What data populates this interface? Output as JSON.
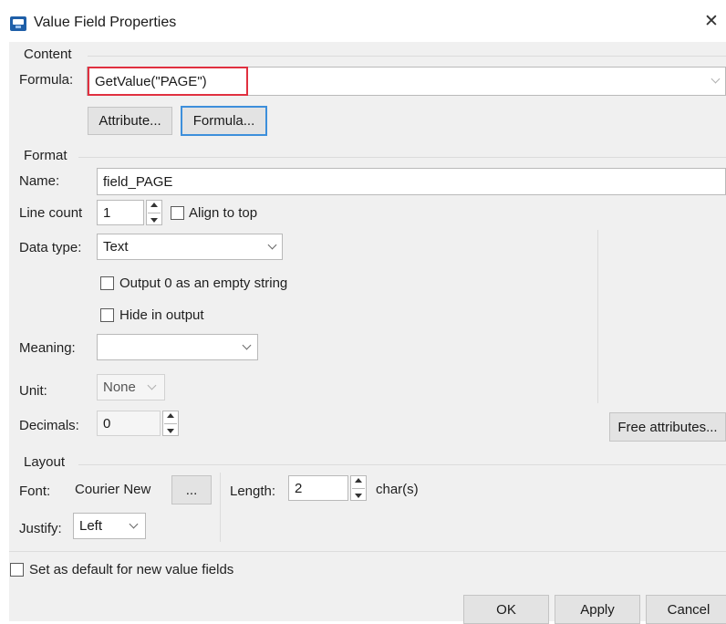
{
  "window": {
    "title": "Value Field Properties",
    "close_glyph": "✕"
  },
  "content": {
    "group_label": "Content",
    "formula_label": "Formula:",
    "formula_value": "GetValue(\"PAGE\")",
    "attribute_button": "Attribute...",
    "formula_button": "Formula..."
  },
  "format": {
    "group_label": "Format",
    "name_label": "Name:",
    "name_value": "field_PAGE",
    "line_count_label": "Line count",
    "line_count_value": "1",
    "align_to_top_label": "Align to top",
    "data_type_label": "Data type:",
    "data_type_value": "Text",
    "output_zero_label": "Output 0 as an empty string",
    "hide_in_output_label": "Hide in output",
    "meaning_label": "Meaning:",
    "meaning_value": "",
    "unit_label": "Unit:",
    "unit_value": "None",
    "decimals_label": "Decimals:",
    "decimals_value": "0",
    "free_attributes_button": "Free attributes..."
  },
  "layout": {
    "group_label": "Layout",
    "font_label": "Font:",
    "font_value": "Courier New",
    "font_button": "...",
    "length_label": "Length:",
    "length_value": "2",
    "length_unit": "char(s)",
    "justify_label": "Justify:",
    "justify_value": "Left"
  },
  "footer": {
    "default_checkbox_label": "Set as default for new value fields",
    "ok_button": "OK",
    "apply_button": "Apply",
    "cancel_button": "Cancel"
  },
  "colors": {
    "highlight_red": "#e03040",
    "focus_blue": "#3d8fdb",
    "dialog_background": "#f0f0f0"
  }
}
